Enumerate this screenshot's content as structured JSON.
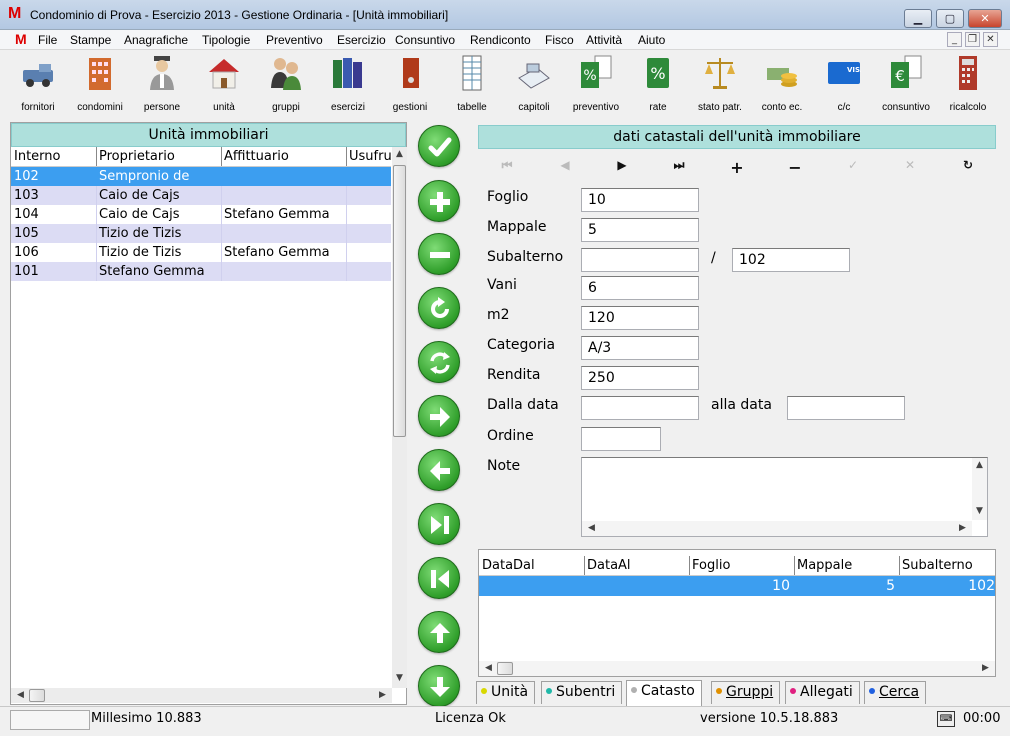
{
  "window": {
    "title": "Condominio di Prova - Esercizio 2013 - Gestione Ordinaria - [Unità immobiliari]",
    "logo": "M"
  },
  "menu": [
    "File",
    "Stampe",
    "Anagrafiche",
    "Tipologie",
    "Preventivo",
    "Esercizio",
    "Consuntivo",
    "Rendiconto",
    "Fisco",
    "Attività",
    "Aiuto"
  ],
  "toolbar": [
    {
      "label": "fornitori",
      "icon": "truck-icon"
    },
    {
      "label": "condomini",
      "icon": "building-icon"
    },
    {
      "label": "persone",
      "icon": "person-icon"
    },
    {
      "label": "unità",
      "icon": "house-icon"
    },
    {
      "label": "gruppi",
      "icon": "group-icon"
    },
    {
      "label": "esercizi",
      "icon": "binders-icon"
    },
    {
      "label": "gestioni",
      "icon": "binder-icon"
    },
    {
      "label": "tabelle",
      "icon": "table-icon"
    },
    {
      "label": "capitoli",
      "icon": "phonebook-icon"
    },
    {
      "label": "preventivo",
      "icon": "percent-doc-icon"
    },
    {
      "label": "rate",
      "icon": "percent-icon"
    },
    {
      "label": "stato patr.",
      "icon": "scale-icon"
    },
    {
      "label": "conto ec.",
      "icon": "coins-icon"
    },
    {
      "label": "c/c",
      "icon": "credit-card-icon"
    },
    {
      "label": "consuntivo",
      "icon": "euro-doc-icon"
    },
    {
      "label": "ricalcolo",
      "icon": "calculator-icon"
    }
  ],
  "left": {
    "title": "Unità immobiliari",
    "columns": [
      "Interno",
      "Proprietario",
      "Affittuario",
      "Usufrutt"
    ],
    "rows": [
      [
        "102",
        "Sempronio de",
        ""
      ],
      [
        "103",
        "Caio de Cajs",
        ""
      ],
      [
        "104",
        "Caio de Cajs",
        "Stefano Gemma"
      ],
      [
        "105",
        "Tizio de Tizis",
        ""
      ],
      [
        "106",
        "Tizio de Tizis",
        "Stefano Gemma"
      ],
      [
        "101",
        "Stefano Gemma",
        ""
      ]
    ]
  },
  "right": {
    "title": "dati catastali dell'unità immobiliare",
    "fields": {
      "foglio": {
        "label": "Foglio",
        "value": "10"
      },
      "mappale": {
        "label": "Mappale",
        "value": "5"
      },
      "subalterno": {
        "label": "Subalterno",
        "value": "",
        "value2": "102",
        "sep": "/"
      },
      "vani": {
        "label": "Vani",
        "value": "6"
      },
      "m2": {
        "label": "m2",
        "value": "120"
      },
      "categoria": {
        "label": "Categoria",
        "value": "A/3"
      },
      "rendita": {
        "label": "Rendita",
        "value": "250"
      },
      "dalla": {
        "label": "Dalla data",
        "value": "",
        "label2": "alla data",
        "value2": ""
      },
      "ordine": {
        "label": "Ordine",
        "value": ""
      },
      "note": {
        "label": "Note",
        "value": ""
      }
    },
    "grid": {
      "columns": [
        "DataDal",
        "DataAl",
        "Foglio",
        "Mappale",
        "Subalterno"
      ],
      "row": [
        "",
        "",
        "10",
        "5",
        "102"
      ]
    }
  },
  "tabs": [
    {
      "label": "Unità",
      "color": "#d8d800"
    },
    {
      "label": "Subentri",
      "color": "#20b8a8"
    },
    {
      "label": "Catasto",
      "color": "#b0b0b0"
    },
    {
      "label": "Gruppi",
      "color": "#e09000"
    },
    {
      "label": "Allegati",
      "color": "#e02080"
    },
    {
      "label": "Cerca",
      "color": "#2060e0"
    }
  ],
  "status": {
    "millesimo": "Millesimo 10.883",
    "licenza": "Licenza Ok",
    "versione": "versione 10.5.18.883",
    "time": "00:00"
  }
}
